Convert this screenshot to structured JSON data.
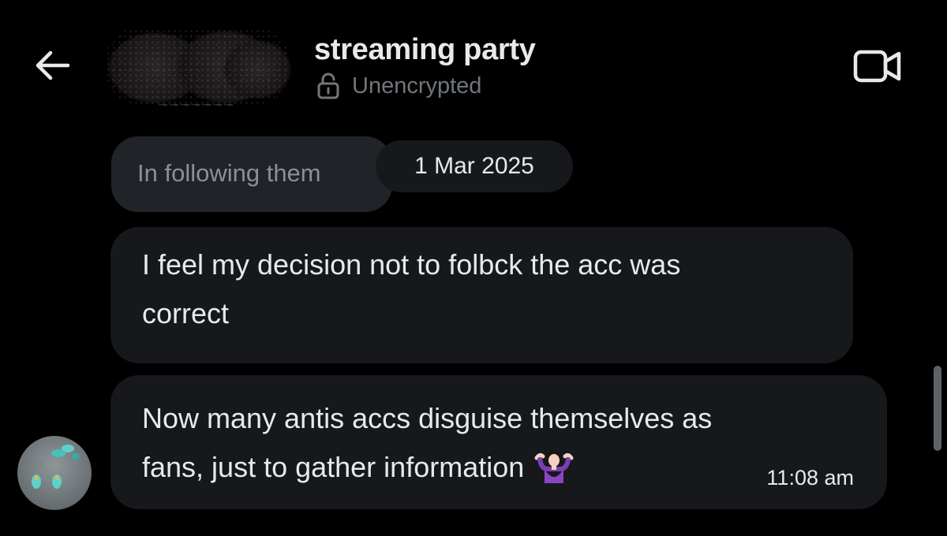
{
  "header": {
    "title": "streaming party",
    "encryption_status": "Unencrypted",
    "back_icon": "arrow-left-icon",
    "lock_icon": "unlocked-padlock-icon",
    "video_icon": "video-camera-icon"
  },
  "thread": {
    "reply_preview": "In following them",
    "date_separator": "1 Mar 2025",
    "messages": [
      {
        "lines": [
          "I feel my decision not to folbck the acc was",
          "correct"
        ]
      },
      {
        "lines": [
          "Now many antis accs disguise themselves as",
          "fans, just to gather information"
        ],
        "emoji": "person-shrugging-emoji",
        "time": "11:08 am"
      }
    ]
  },
  "colors": {
    "background": "#000000",
    "bubble": "#16181c",
    "reply_bubble": "#202327",
    "primary_text": "#e7e9ea",
    "secondary_text": "#71767b"
  }
}
